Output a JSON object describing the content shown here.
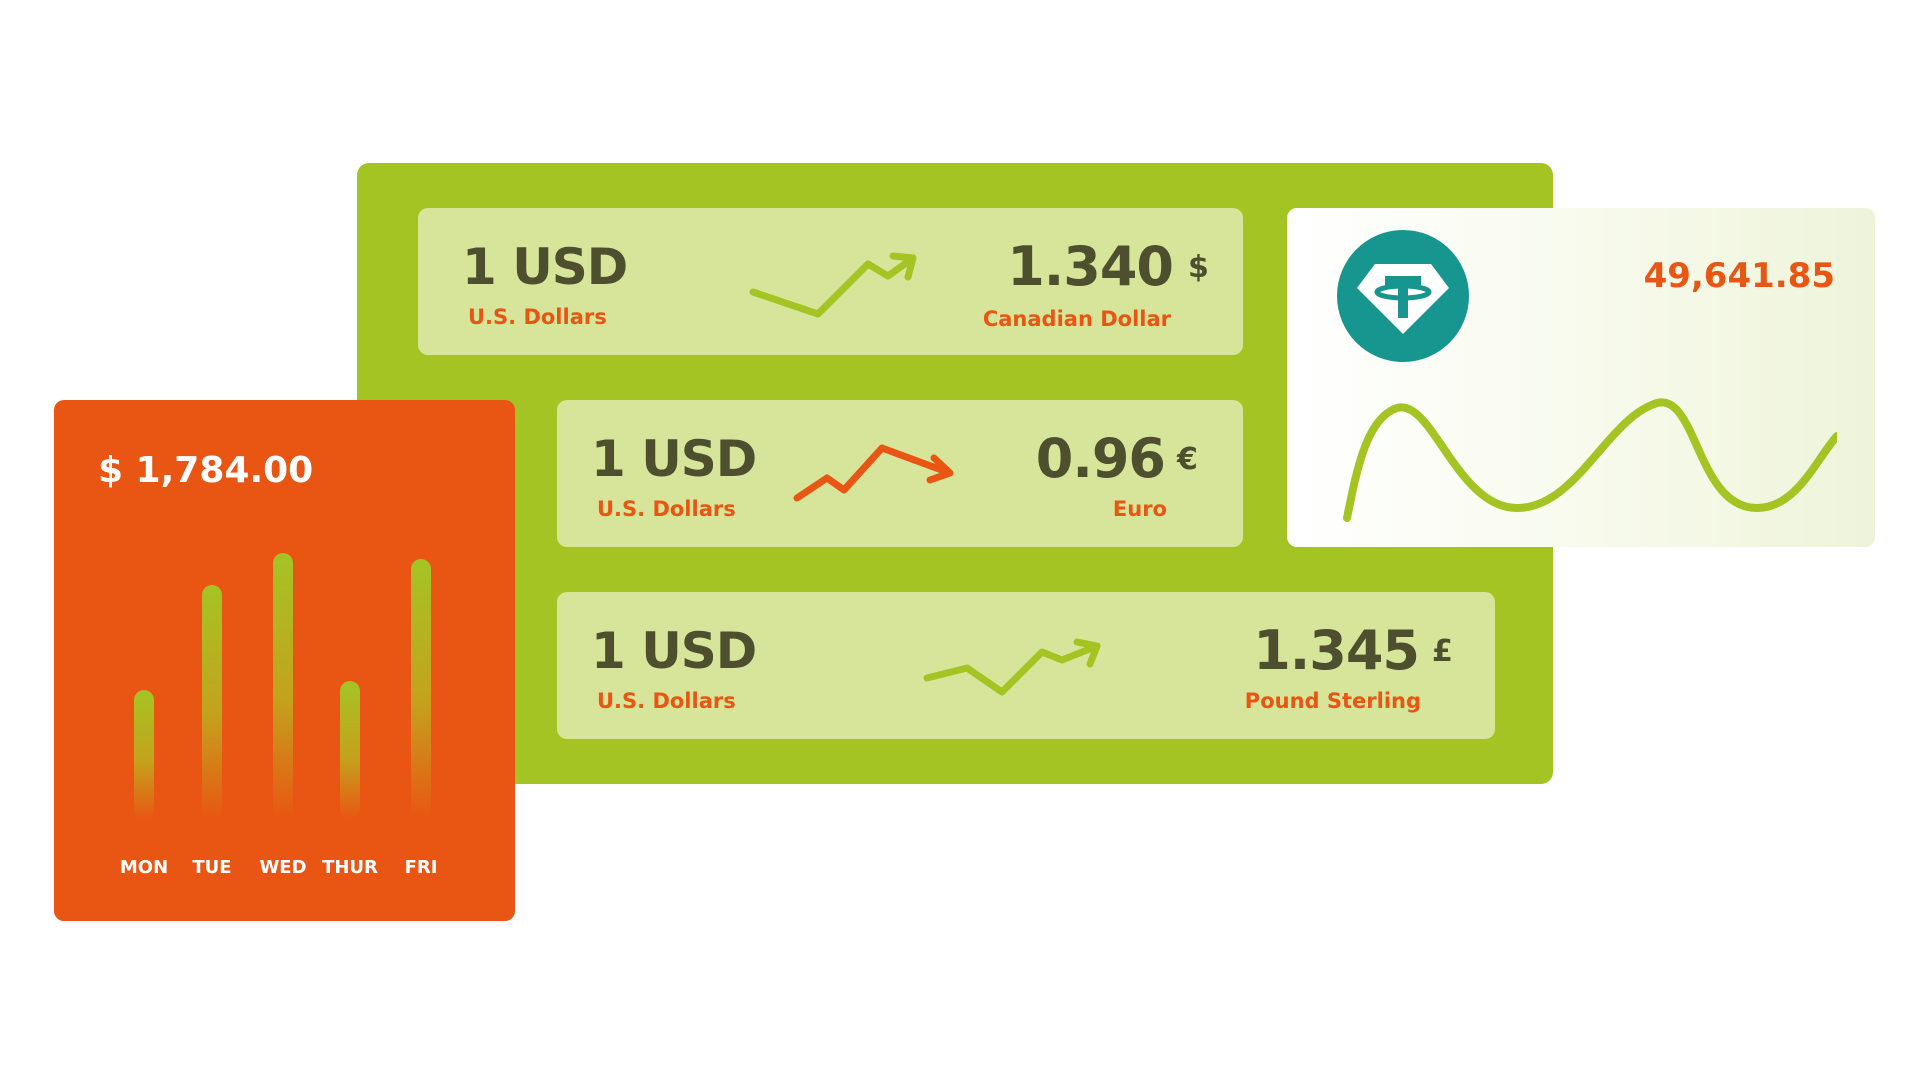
{
  "rates": [
    {
      "base_amount": "1 USD",
      "base_name": "U.S. Dollars",
      "trend": "up-trend-arrow-icon",
      "trend_color": "#a4c424",
      "rate": "1.340",
      "symbol": "$",
      "currency_name": "Canadian Dollar"
    },
    {
      "base_amount": "1 USD",
      "base_name": "U.S. Dollars",
      "trend": "down-trend-arrow-icon",
      "trend_color": "#e95512",
      "rate": "0.96",
      "symbol": "€",
      "currency_name": "Euro"
    },
    {
      "base_amount": "1 USD",
      "base_name": "U.S. Dollars",
      "trend": "up-trend-arrow-icon",
      "trend_color": "#a4c424",
      "rate": "1.345",
      "symbol": "£",
      "currency_name": "Pound Sterling"
    }
  ],
  "crypto": {
    "logo_icon": "tether-logo-icon",
    "logo_color": "#17968f",
    "value": "49,641.85",
    "line_color": "#a4c424"
  },
  "weekly": {
    "total": "$ 1,784.00",
    "chart_data": {
      "type": "bar",
      "categories": [
        "MON",
        "TUE",
        "WED",
        "THUR",
        "FRI"
      ],
      "values": [
        45,
        81,
        92,
        48,
        90
      ],
      "ylim": [
        0,
        100
      ],
      "grid": false
    }
  },
  "colors": {
    "panel_green": "#a4c424",
    "card_green": "#d6e59a",
    "accent_orange": "#e95512",
    "text_dark": "#4d4f2e"
  }
}
